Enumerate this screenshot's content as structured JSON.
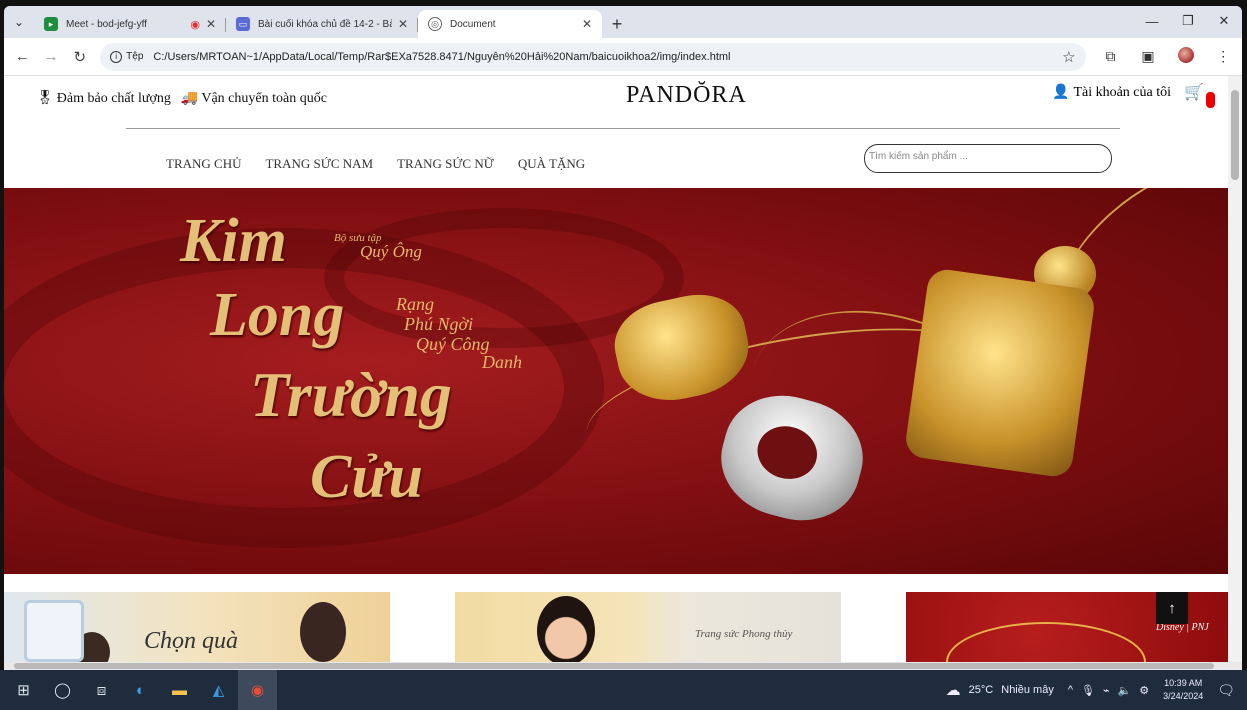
{
  "browser": {
    "tabs": [
      {
        "title": "Meet - bod-jefg-yff",
        "favicon": "meet-icon",
        "fav_color": "#1e8e3e",
        "recording": true
      },
      {
        "title": "Bài cuối khóa chủ đề 14-2 - Bà",
        "favicon": "chat-icon",
        "fav_color": "#5b6bd6"
      },
      {
        "title": "Document",
        "favicon": "globe-icon",
        "fav_color": "#666"
      }
    ],
    "site_label": "Tệp",
    "url": "C:/Users/MRTOAN~1/AppData/Local/Temp/Rar$EXa7528.8471/Nguyễn%20Hải%20Nam/baicuoikhoa2/img/index.html"
  },
  "site": {
    "badge_quality": "Đảm bảo chất lượng",
    "badge_shipping": "Vận chuyển toàn quốc",
    "brand": "PANDŎRA",
    "account": "Tài khoản của tôi",
    "nav": [
      "TRANG CHỦ",
      "TRANG SỨC NAM",
      "TRANG SỨC NỮ",
      "QUÀ TẶNG"
    ],
    "search_placeholder": "Tìm kiếm sản phẩm ...",
    "hero": {
      "title_lines": [
        "Kim",
        "Long",
        "Trường",
        "Cửu"
      ],
      "collection": "Bộ sưu tập",
      "collection_name": "Quý Ông",
      "tagline": [
        "Rạng",
        "Phú Ngời",
        "Quý Công",
        "Danh"
      ]
    },
    "banner1_text": "Chọn quà",
    "banner2_text": "Trang sức Phong thủy",
    "banner3_text": "Disney | PNJ"
  },
  "taskbar": {
    "weather": "25°C",
    "weather_desc": "Nhiều mây",
    "time": "10:39 AM",
    "date": "3/24/2024"
  },
  "colors": {
    "hero_red": "#8e0c0c",
    "gold": "#e4bf78",
    "cart_badge": "#e00000"
  }
}
